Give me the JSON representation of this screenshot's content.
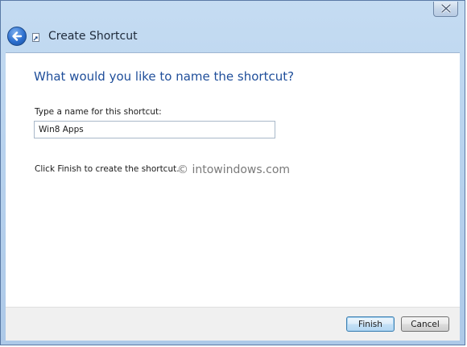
{
  "window": {
    "title": "Create Shortcut",
    "icons": {
      "close": "close-icon",
      "back": "back-arrow-icon",
      "shortcut": "shortcut-icon"
    },
    "accent_color": "#1f4e9a"
  },
  "content": {
    "heading": "What would you like to name the shortcut?",
    "field_label": "Type a name for this shortcut:",
    "name_value": "Win8 Apps",
    "hint": "Click Finish to create the shortcut.",
    "watermark": "© intowindows.com"
  },
  "footer": {
    "finish_label": "Finish",
    "cancel_label": "Cancel"
  }
}
